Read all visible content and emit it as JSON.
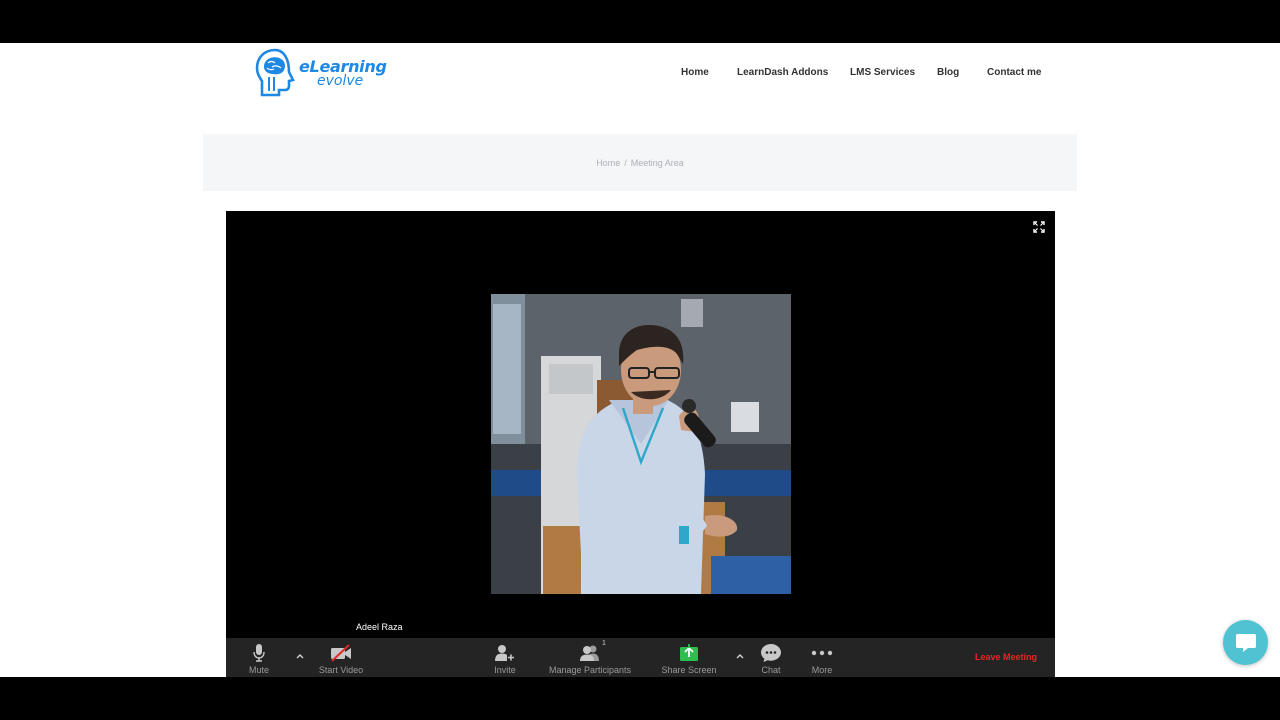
{
  "brand": {
    "line1": "eLearning",
    "line2": "evolve",
    "color": "#1e88e5"
  },
  "nav": [
    {
      "label": "Home"
    },
    {
      "label": "LearnDash Addons"
    },
    {
      "label": "LMS Services"
    },
    {
      "label": "Blog"
    },
    {
      "label": "Contact me"
    }
  ],
  "breadcrumb": {
    "home": "Home",
    "separator": "/",
    "current": "Meeting Area"
  },
  "meeting": {
    "participant_name": "Adeel Raza",
    "toolbar": {
      "mute": "Mute",
      "start_video": "Start Video",
      "invite": "Invite",
      "manage_participants": "Manage Participants",
      "participant_count": "1",
      "share_screen": "Share Screen",
      "chat": "Chat",
      "more": "More",
      "leave": "Leave Meeting"
    },
    "colors": {
      "share": "#2dbe4f",
      "leave": "#e02828",
      "video_off": "#e02828"
    }
  },
  "icons": {
    "fullscreen": "fullscreen-icon",
    "mic": "microphone-icon",
    "video": "video-off-icon",
    "invite": "invite-icon",
    "participants": "participants-icon",
    "share": "share-screen-icon",
    "chat": "chat-icon",
    "more": "more-icon",
    "support": "support-chat-icon"
  }
}
